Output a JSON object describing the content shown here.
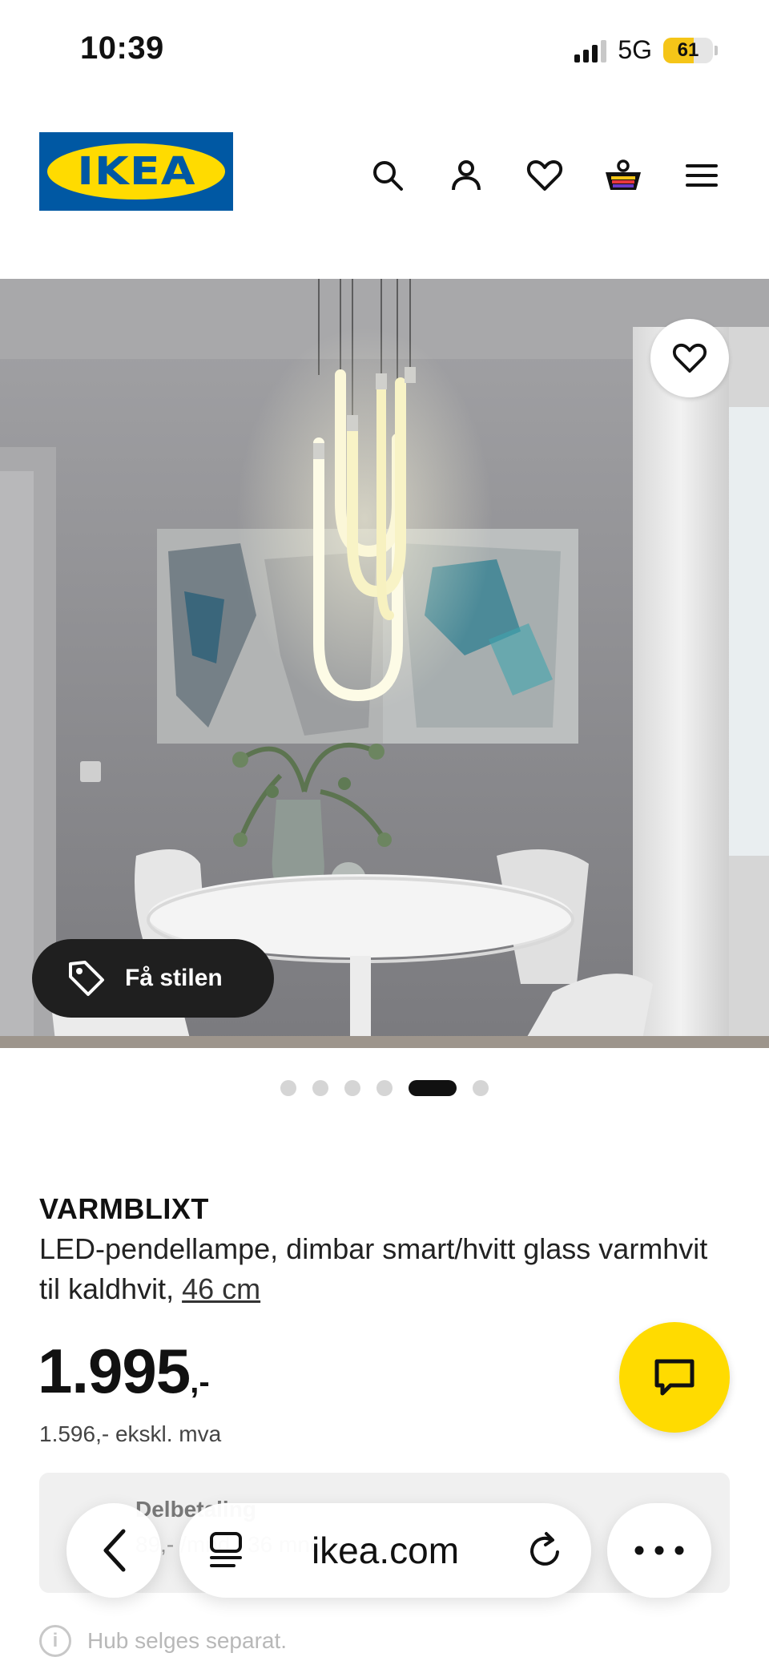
{
  "status_bar": {
    "time": "10:39",
    "network": "5G",
    "battery": "61",
    "battery_level": 0.61
  },
  "header": {
    "logo_text": "IKEA",
    "icons": [
      "search-icon",
      "account-icon",
      "wishlist-icon",
      "cart-icon",
      "menu-icon"
    ]
  },
  "gallery": {
    "style_button_label": "Få stilen",
    "dot_count": 6,
    "active_dot": 4
  },
  "product": {
    "name": "VARMBLIXT",
    "description": "LED-pendellampe, dimbar smart/hvitt glass varmhvit til kaldhvit,",
    "size": "46 cm",
    "price": "1.995",
    "price_suffix": ",-",
    "price_ex_vat": "1.596,- ekskl. mva"
  },
  "part_payment": {
    "title": "Delbetaling",
    "line": "89,- /mnd i 36 mnd"
  },
  "browser": {
    "url": "ikea.com"
  },
  "note": {
    "text": "Hub selges separat."
  },
  "colors": {
    "ikea_blue": "#0058a3",
    "ikea_yellow": "#ffdb00"
  }
}
